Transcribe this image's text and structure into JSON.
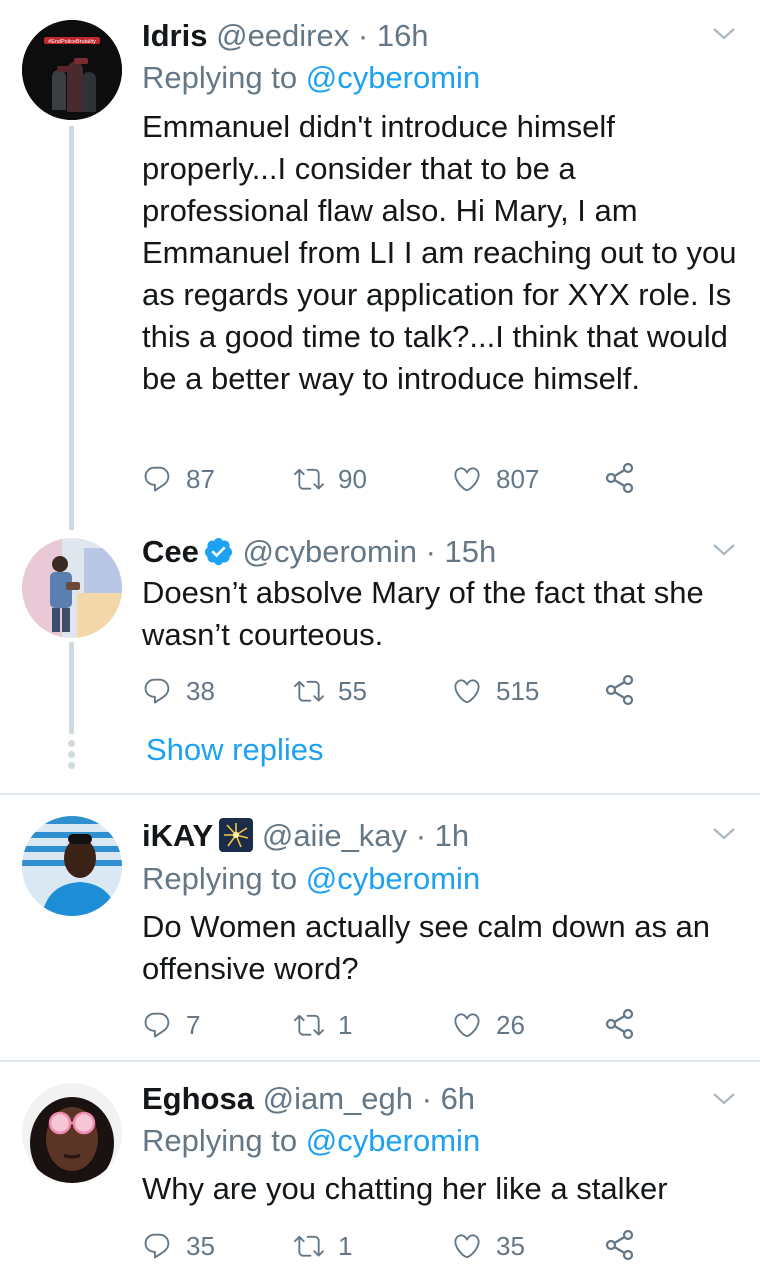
{
  "tweets": [
    {
      "name": "Idris",
      "handle": "@eedirex",
      "sep": "·",
      "time": "16h",
      "replying_prefix": "Replying to",
      "replying_mention": "@cyberomin",
      "text": "Emmanuel didn't introduce himself properly...I consider that to be a professional flaw also. Hi Mary, I am Emmanuel from LI I am reaching out to you as regards your application for XYX role. Is this a good time to talk?...I think that would be a better way to introduce himself.",
      "replies": "87",
      "retweets": "90",
      "likes": "807",
      "avatar_text": "#EndPoliceBrutality"
    },
    {
      "name": "Cee",
      "handle": "@cyberomin",
      "sep": "·",
      "time": "15h",
      "text": "Doesn’t absolve Mary of the fact that she wasn’t courteous.",
      "replies": "38",
      "retweets": "55",
      "likes": "515",
      "show_replies": "Show replies"
    },
    {
      "name": "iKAY",
      "handle": "@aiie_kay",
      "sep": "·",
      "time": "1h",
      "replying_prefix": "Replying to",
      "replying_mention": "@cyberomin",
      "text": "Do Women actually see calm down as an offensive word?",
      "replies": "7",
      "retweets": "1",
      "likes": "26"
    },
    {
      "name": "Eghosa",
      "handle": "@iam_egh",
      "sep": "·",
      "time": "6h",
      "replying_prefix": "Replying to",
      "replying_mention": "@cyberomin",
      "text": "Why are you chatting her like a stalker",
      "replies": "35",
      "retweets": "1",
      "likes": "35"
    }
  ],
  "colors": {
    "text": "#14171a",
    "secondary": "#657786",
    "accent": "#1da1f2",
    "thread_line": "#cfd9de",
    "divider": "#e1e8ed"
  },
  "icons": [
    "reply-icon",
    "retweet-icon",
    "like-icon",
    "share-icon",
    "chevron-down-icon",
    "verified-icon"
  ]
}
